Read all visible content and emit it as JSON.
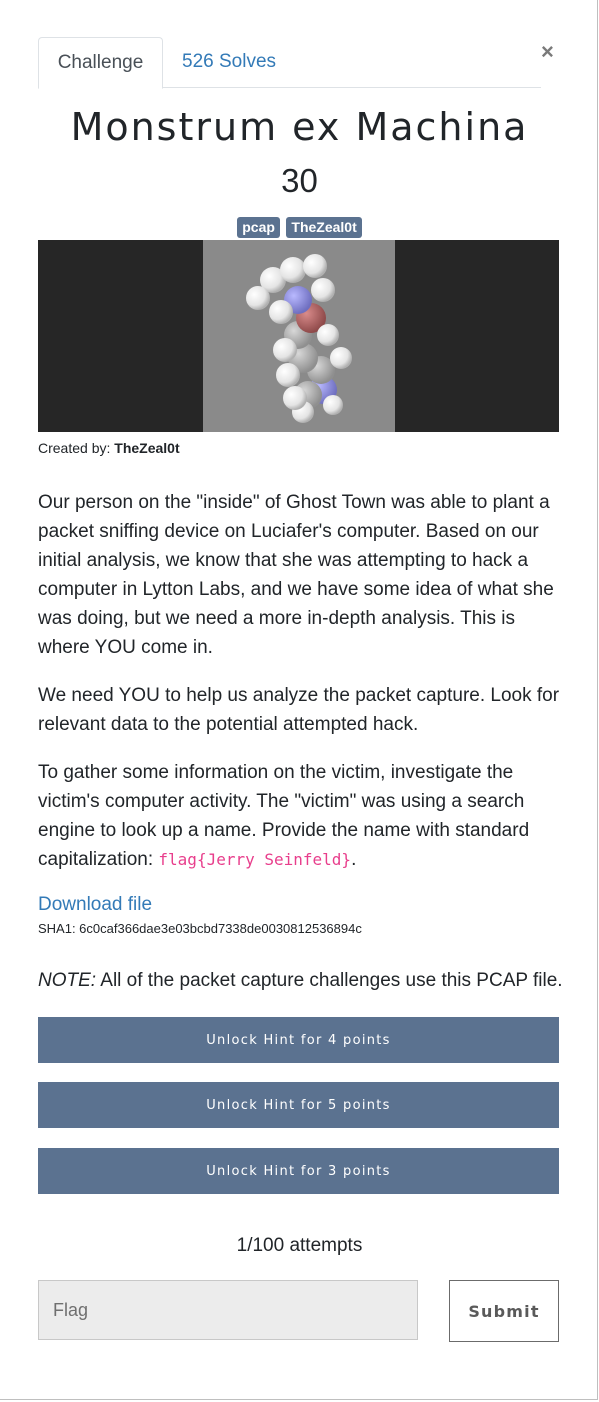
{
  "modal": {
    "close_label": "×"
  },
  "tabs": [
    {
      "label": "Challenge"
    },
    {
      "label": "526 Solves"
    }
  ],
  "challenge": {
    "title": "Monstrum ex Machina",
    "value": "30",
    "tags": [
      "pcap",
      "TheZeal0t"
    ],
    "created_by_label": "Created by:",
    "created_by_name": "TheZeal0t",
    "description_p1": "Our person on the \"inside\" of Ghost Town was able to plant a packet sniffing device on Luciafer's computer. Based on our initial analysis, we know that she was attempting to hack a computer in Lytton Labs, and we have some idea of what she was doing, but we need a more in-depth analysis. This is where YOU come in.",
    "description_p2": "We need YOU to help us analyze the packet capture. Look for relevant data to the potential attempted hack.",
    "description_p3_pre": "To gather some information on the victim, investigate the victim's computer activity. The \"victim\" was using a search engine to look up a name. Provide the name with standard capitalization: ",
    "description_p3_code": "flag{Jerry Seinfeld}",
    "description_p3_post": ".",
    "download_label": "Download file",
    "sha1": "SHA1: 6c0caf366dae3e03bcbd7338de0030812536894c",
    "note_label": "NOTE:",
    "note_text": " All of the packet capture challenges use this PCAP file."
  },
  "hints": [
    {
      "label": "Unlock Hint for 4 points"
    },
    {
      "label": "Unlock Hint for 5 points"
    },
    {
      "label": "Unlock Hint for 3 points"
    }
  ],
  "attempts": "1/100 attempts",
  "flag_input": {
    "placeholder": "Flag",
    "value": ""
  },
  "submit_label": "Submit",
  "colors": {
    "accent": "#5b7290",
    "link": "#337ab7",
    "code": "#e83e8c"
  }
}
